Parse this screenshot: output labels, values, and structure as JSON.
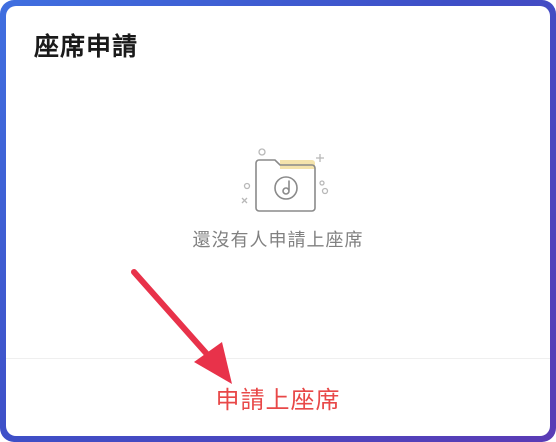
{
  "dialog": {
    "title": "座席申請",
    "empty_state": {
      "message": "還沒有人申請上座席",
      "icon": "empty-music-folder-icon"
    },
    "apply_button_label": "申請上座席"
  },
  "colors": {
    "frame_border": "#3e4fc7",
    "apply_button": "#e84848",
    "annotation_arrow": "#e8324a",
    "empty_text": "#808080"
  }
}
